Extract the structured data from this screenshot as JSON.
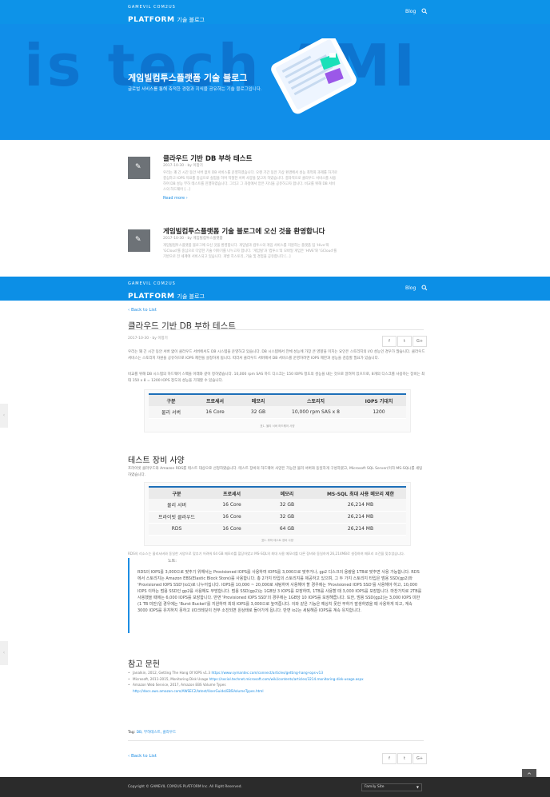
{
  "brand": {
    "small": "GAMEVIL COM2US",
    "big": "PLATFORM",
    "sub": "기술 블로그"
  },
  "nav": {
    "blog": "Blog",
    "search_icon": "search-icon"
  },
  "hero": {
    "bgtext": "is tech AMI",
    "title": "게임빌컴투스플랫폼 기술 블로그",
    "subtitle": "글로벌 서비스를 통해 축적한 경험과 지식을 공유하는 기술 블로그입니다."
  },
  "posts": [
    {
      "title": "클라우드 기반 DB 부하 테스트",
      "meta": "2017-10-30 · by 이창기",
      "excerpt": "우리는 꽤 긴 시간 동안 서버 없이 DB 서비스를 운영하였습니다. 오랜 기간 동안 가상 환경에서 성능 최적화 과제를 하기로 결심하고 IOPS 지표를 중심으로 실험을 하여 적절한 서버 사양을 찾고자 하였습니다. 결과적으로 클라우드 서비스를 사용하여 DB 성능 부하 테스트를 진행하였습니다. 그리고 그 과정에서 얻은 지식을 공유하고자 합니다. 비교를 위해 DB 서비스의 하드웨어 [...]",
      "readmore": "Read more ›"
    },
    {
      "title": "게임빌컴투스플랫폼 기술 블로그에 오신 것을 환영합니다",
      "meta": "2017-10-30 · by 게임빌컴투스플랫폼",
      "excerpt": "게임빌컴투스플랫폼 블로그에 오신 것을 환영합니다. 게임빌과 컴투스의 게임 서비스를 지원하는 플랫폼 팀 'Hive'와 'GCloud'를 중심으로 다양한 기술 이야기를 나누고자 합니다. '게임빌'과 '컴투스'의 모바일 게임은 'HIVE'와 'GCloud'를 기반으로 전 세계에 서비스되고 있습니다. 개발 히스토리, 기술 및 경험을 공유합니다 [...]"
    }
  ],
  "article": {
    "back": "‹ Back to List",
    "title": "클라우드 기반 DB 부하 테스트",
    "meta": "2017-10-30 · by 이창기",
    "share": [
      "f",
      "t",
      "G+"
    ],
    "p1": "우리는 꽤 긴 시간 동안 서버 없이 클라우드 서버에서도 DB 시스템을 운영하고 있습니다. DB 시스템에서 전체 성능에 가장 큰 영향을 미치는 요인은 스토리지의 I/O 성능인 경우가 많습니다. 클라우드 서비스는 스토리지 자원을 공유하므로 IOPS 제한을 설정하게 됩니다. 따라서 클라우드 서버에서 DB 서비스를 운영하려면 IOPS 제한과 성능을 검증할 필요가 있습니다.",
    "p2": "비교를 위해 DB 시스템의 하드웨어 스펙을 아래와 같이 정하였습니다. 10,000 rpm SAS 하드 디스크는 150 IOPS 정도의 성능을 내는 것으로 알려져 있으므로, 8개의 디스크를 사용하는 장비는 최대 150 x 8 = 1200 IOPS 정도의 성능을 기대할 수 있습니다.",
    "table1": {
      "headers": [
        "구분",
        "프로세서",
        "메모리",
        "스토리지",
        "IOPS 기대치"
      ],
      "rows": [
        [
          "물리 서버",
          "16 Core",
          "32 GB",
          "10,000 rpm SAS x 8",
          "1200"
        ]
      ],
      "caption": "표1. 물리 서버 하드웨어 사양"
    },
    "h2_spec": "테스트 장비 사양",
    "p3": "프라이빗 클라우드와 Amazon RDS를 테스트 대상으로 선정하였습니다. 테스트 장비의 하드웨어 사양은 가능한 물리 서버와 동일하게 구성하였고, Microsoft SQL Server(이하 MS-SQL)를 세팅 하였습니다.",
    "table2": {
      "headers": [
        "구분",
        "프로세서",
        "메모리",
        "MS-SQL 최대 사용 메모리 제한"
      ],
      "rows": [
        [
          "물리 서버",
          "16 Core",
          "32 GB",
          "26,214 MB"
        ],
        [
          "프라이빗 클라우드",
          "16 Core",
          "32 GB",
          "26,214 MB"
        ],
        [
          "RDS",
          "16 Core",
          "64 GB",
          "26,214 MB"
        ]
      ],
      "caption": "표2. 부하 테스트 장비 사양"
    },
    "note": "RDS의 리소스는 물리서버와 동일한 사양으로 맞추기 어려워 64 GB 메모리를 할당하였고 MS-SQL의 최대 사용 메모리를 다른 장비와 동일하게 26,214MB로 설정하여 메모리 조건을 맞추었습니다.",
    "quote_label": "노트:",
    "quote": "RDS의 IOPS를 3,000으로 맞추기 위해서는 Provisioned IOPS를 사용하여 IOPS를 3,000으로 맞추거나, gp2 디스크의 용량을 1TB로 맞추면 사용 가능합니다. RDS에서 스토리지는 Amazon EBS(Elastic Block Store)를 사용합니다. 총 2가지 타입의 스토리지를 제공하고 있으며, 그 두 가지 스토리지 타입은 범용 SSD(gp2)와 'Provisioned IOPS SSD'(io1)로 나누어집니다. IOPS를 10,000 ~ 20,000로 세팅하여 사용해야 할 경우에는 'Provisioned IOPS SSD'를 사용해야 하고, 10,000 IOPS 이하는 범용 SSD인 gp2를 사용해도 무방합니다. 범용 SSD(gp2)는 1GB당 3 IOPS를 보장하며, 1TB를 사용할 때 3,000 IOPS를 보장합니다. 마찬가지로 2TB를 사용했을 때에는 6,000 IOPS를 보장합니다. 반면 'Provisioned IOPS SSD'의 경우에는 1GB당 10 IOPS를 보장해줍니다. 또한, 범용 SSD(gp2)는 3,000 IOPS 미만(1 TB 미만)일 경우에는 'Burst Bucket'를 지원하여 최대 IOPS를 3,000으로 높여줍니다. 이와 같은 기능은 예상치 못한 부하가 발생하였을 때 사용하게 되고, 계속 3000 IOPS를 유지하지 못하고 I/O크레딧이 전부 소진되면 원상태로 돌아가게 됩니다. 반면 io2는 세팅해준 IOPS를 계속 유지합니다.",
    "h2_refs": "참고 문헌",
    "refs": [
      {
        "text": "Janalkin, 2012, Getting The Hang Of IOPS v1.3",
        "link": "https://www.symantec.com/connect/articles/getting-hang-iops-v13"
      },
      {
        "text": "Microsoft, 2011-2015, Monitoring Disk Usage",
        "link": "https://social.technet.microsoft.com/wiki/contents/articles/3214.monitoring-disk-usage.aspx"
      },
      {
        "text": "Amazon Web Service, 2017, Amazon EBS Volume Types",
        "link": "http://docs.aws.amazon.com/AWSEC2/latest/UserGuide/EBSVolumeTypes.html"
      }
    ],
    "tags_label": "Tag:",
    "tags_value": "DB, 부하테스트, 클라우드",
    "back2": "‹ Back to List"
  },
  "footer": {
    "copyright": "Copyright © GAMEVIL COM2US PLATFORM Inc. All Right Reserved.",
    "family_site": "Family Site",
    "totop": "^"
  }
}
